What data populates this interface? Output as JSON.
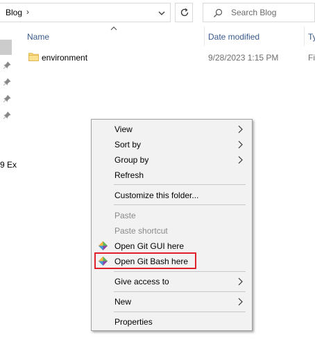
{
  "address": {
    "path": "Blog",
    "separator": "›"
  },
  "search": {
    "placeholder": "Search Blog"
  },
  "nav": {
    "truncated_text": "9 Ex"
  },
  "columns": {
    "name": "Name",
    "date": "Date modified",
    "type": "Ty"
  },
  "files": [
    {
      "name": "environment",
      "date": "9/28/2023 1:15 PM",
      "type": "Fi"
    }
  ],
  "context_menu": {
    "items": [
      {
        "label": "View",
        "submenu": true
      },
      {
        "label": "Sort by",
        "submenu": true
      },
      {
        "label": "Group by",
        "submenu": true
      },
      {
        "label": "Refresh"
      },
      {
        "label": "Customize this folder..."
      },
      {
        "label": "Paste",
        "disabled": true
      },
      {
        "label": "Paste shortcut",
        "disabled": true
      },
      {
        "label": "Open Git GUI here",
        "icon": "git-icon"
      },
      {
        "label": "Open Git Bash here",
        "icon": "git-icon",
        "highlighted": true
      },
      {
        "label": "Give access to",
        "submenu": true
      },
      {
        "label": "New",
        "submenu": true
      },
      {
        "label": "Properties"
      }
    ]
  },
  "colors": {
    "highlight": "#e0202a",
    "header_text": "#3a5a8a",
    "menu_bg": "#f2f2f2"
  }
}
